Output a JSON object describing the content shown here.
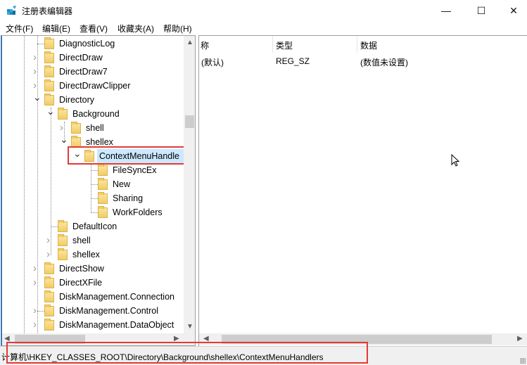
{
  "window": {
    "title": "注册表编辑器",
    "minimize_label": "—",
    "maximize_label": "☐",
    "close_label": "✕"
  },
  "menu": [
    {
      "label": "文件(F)"
    },
    {
      "label": "编辑(E)"
    },
    {
      "label": "查看(V)"
    },
    {
      "label": "收藏夹(A)"
    },
    {
      "label": "帮助(H)"
    }
  ],
  "tree": {
    "items": [
      {
        "label": "DiagnosticLog",
        "level": 0,
        "expander": "none"
      },
      {
        "label": "DirectDraw",
        "level": 0,
        "expander": "collapsed"
      },
      {
        "label": "DirectDraw7",
        "level": 0,
        "expander": "collapsed"
      },
      {
        "label": "DirectDrawClipper",
        "level": 0,
        "expander": "collapsed"
      },
      {
        "label": "Directory",
        "level": 0,
        "expander": "expanded"
      },
      {
        "label": "Background",
        "level": 1,
        "expander": "expanded"
      },
      {
        "label": "shell",
        "level": 2,
        "expander": "collapsed"
      },
      {
        "label": "shellex",
        "level": 2,
        "expander": "expanded"
      },
      {
        "label": "ContextMenuHandle",
        "level": 3,
        "expander": "expanded",
        "selected": true
      },
      {
        "label": "FileSyncEx",
        "level": 4,
        "expander": "none"
      },
      {
        "label": "New",
        "level": 4,
        "expander": "none"
      },
      {
        "label": "Sharing",
        "level": 4,
        "expander": "none"
      },
      {
        "label": "WorkFolders",
        "level": 4,
        "expander": "none"
      },
      {
        "label": "DefaultIcon",
        "level": 1,
        "expander": "none"
      },
      {
        "label": "shell",
        "level": 1,
        "expander": "collapsed"
      },
      {
        "label": "shellex",
        "level": 1,
        "expander": "collapsed"
      },
      {
        "label": "DirectShow",
        "level": 0,
        "expander": "collapsed"
      },
      {
        "label": "DirectXFile",
        "level": 0,
        "expander": "collapsed"
      },
      {
        "label": "DiskManagement.Connection",
        "level": 0,
        "expander": "none"
      },
      {
        "label": "DiskManagement.Control",
        "level": 0,
        "expander": "collapsed"
      },
      {
        "label": "DiskManagement.DataObject",
        "level": 0,
        "expander": "collapsed"
      }
    ]
  },
  "values_table": {
    "columns": [
      "称",
      "类型",
      "数据"
    ],
    "rows": [
      {
        "name": "(默认)",
        "type": "REG_SZ",
        "data": "(数值未设置)"
      }
    ]
  },
  "statusbar": {
    "path": "计算机\\HKEY_CLASSES_ROOT\\Directory\\Background\\shellex\\ContextMenuHandlers"
  },
  "colors": {
    "highlight_box": "#e53935",
    "selection": "#cce8ff",
    "folder": "#f2cc64"
  }
}
